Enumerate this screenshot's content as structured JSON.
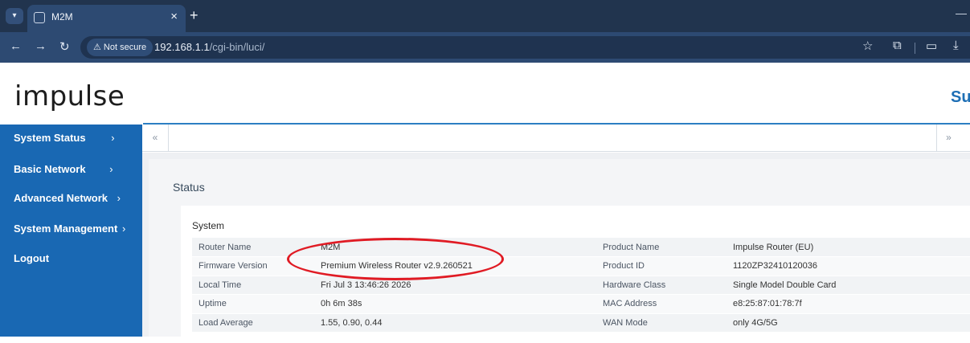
{
  "browser": {
    "tab_title": "M2M",
    "close_symbol": "×",
    "new_tab_symbol": "+",
    "security_label": "⚠ Not secure",
    "url_host": "192.168.1.1",
    "url_path": "/cgi-bin/luci/",
    "icons": [
      "tab-menu-icon",
      "favicon-icon",
      "back-icon",
      "forward-icon",
      "reload-icon",
      "star-icon",
      "extensions-icon",
      "cast-icon",
      "download-icon"
    ]
  },
  "header": {
    "logo_text": "impulse",
    "right_text": "Su"
  },
  "sidebar": {
    "items": [
      {
        "label": "System Status",
        "chevron": "›"
      },
      {
        "label": "Basic Network",
        "chevron": "›"
      },
      {
        "label": "Advanced Network",
        "chevron": "›"
      },
      {
        "label": "System Management",
        "chevron": "›"
      },
      {
        "label": "Logout",
        "chevron": ""
      }
    ]
  },
  "tabstrip": {
    "left_arrow": "«",
    "right_arrow": "»"
  },
  "main": {
    "title": "Status",
    "section_title": "System",
    "rows": [
      {
        "label1": "Router Name",
        "value1": "M2M",
        "label2": "Product Name",
        "value2": "Impulse Router (EU)"
      },
      {
        "label1": "Firmware Version",
        "value1": "Premium Wireless Router v2.9.260521",
        "label2": "Product ID",
        "value2": "1120ZP32410120036"
      },
      {
        "label1": "Local Time",
        "value1": "Fri Jul 3 13:46:26 2026",
        "label2": "Hardware Class",
        "value2": "Single Model Double Card"
      },
      {
        "label1": "Uptime",
        "value1": "0h 6m 38s",
        "label2": "MAC Address",
        "value2": "e8:25:87:01:78:7f"
      },
      {
        "label1": "Load Average",
        "value1": "1.55, 0.90, 0.44",
        "label2": "WAN Mode",
        "value2": "only 4G/5G"
      }
    ]
  },
  "colors": {
    "sidebar_bg": "#1968b3",
    "browser_bg": "#21344e",
    "accent": "#1e6fb5",
    "annotation": "#e01b24"
  }
}
